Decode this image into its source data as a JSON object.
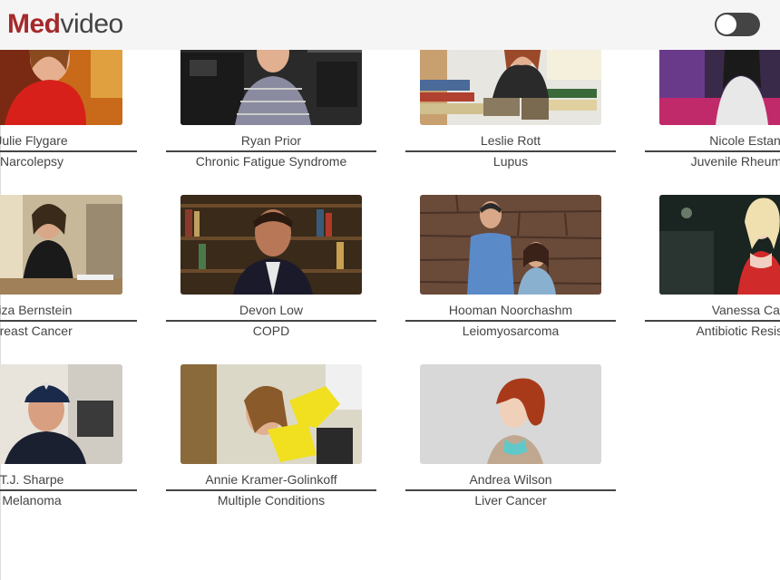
{
  "header": {
    "logo_part1": "Med",
    "logo_part2": "video",
    "toggle_state": "off"
  },
  "profiles": [
    {
      "name": "Julie Flygare",
      "condition": "Narcolepsy",
      "photo": "woman-red-top-stage-icon"
    },
    {
      "name": "Ryan Prior",
      "condition": "Chronic Fatigue Syndrome",
      "photo": "man-plaid-shirt-studio-icon"
    },
    {
      "name": "Leslie Rott",
      "condition": "Lupus",
      "photo": "woman-sitting-books-icon"
    },
    {
      "name": "Nicole Estanol",
      "condition": "Juvenile Rheumatoid",
      "photo": "woman-speaking-stage-icon"
    },
    {
      "name": "Liza Bernstein",
      "condition": "Breast Cancer",
      "photo": "woman-at-desk-icon"
    },
    {
      "name": "Devon Low",
      "condition": "COPD",
      "photo": "man-bookshelf-icon"
    },
    {
      "name": "Hooman Noorchashm",
      "condition": "Leiomyosarcoma",
      "photo": "couple-stone-wall-icon"
    },
    {
      "name": "Vanessa Carr",
      "condition": "Antibiotic Resistant",
      "photo": "woman-night-street-icon"
    },
    {
      "name": "T.J. Sharpe",
      "condition": "Melanoma",
      "photo": "man-cap-icon"
    },
    {
      "name": "Annie Kramer-Golinkoff",
      "condition": "Multiple Conditions",
      "photo": "woman-yellow-brace-icon"
    },
    {
      "name": "Andrea Wilson",
      "condition": "Liver Cancer",
      "photo": "woman-red-hair-icon"
    }
  ]
}
